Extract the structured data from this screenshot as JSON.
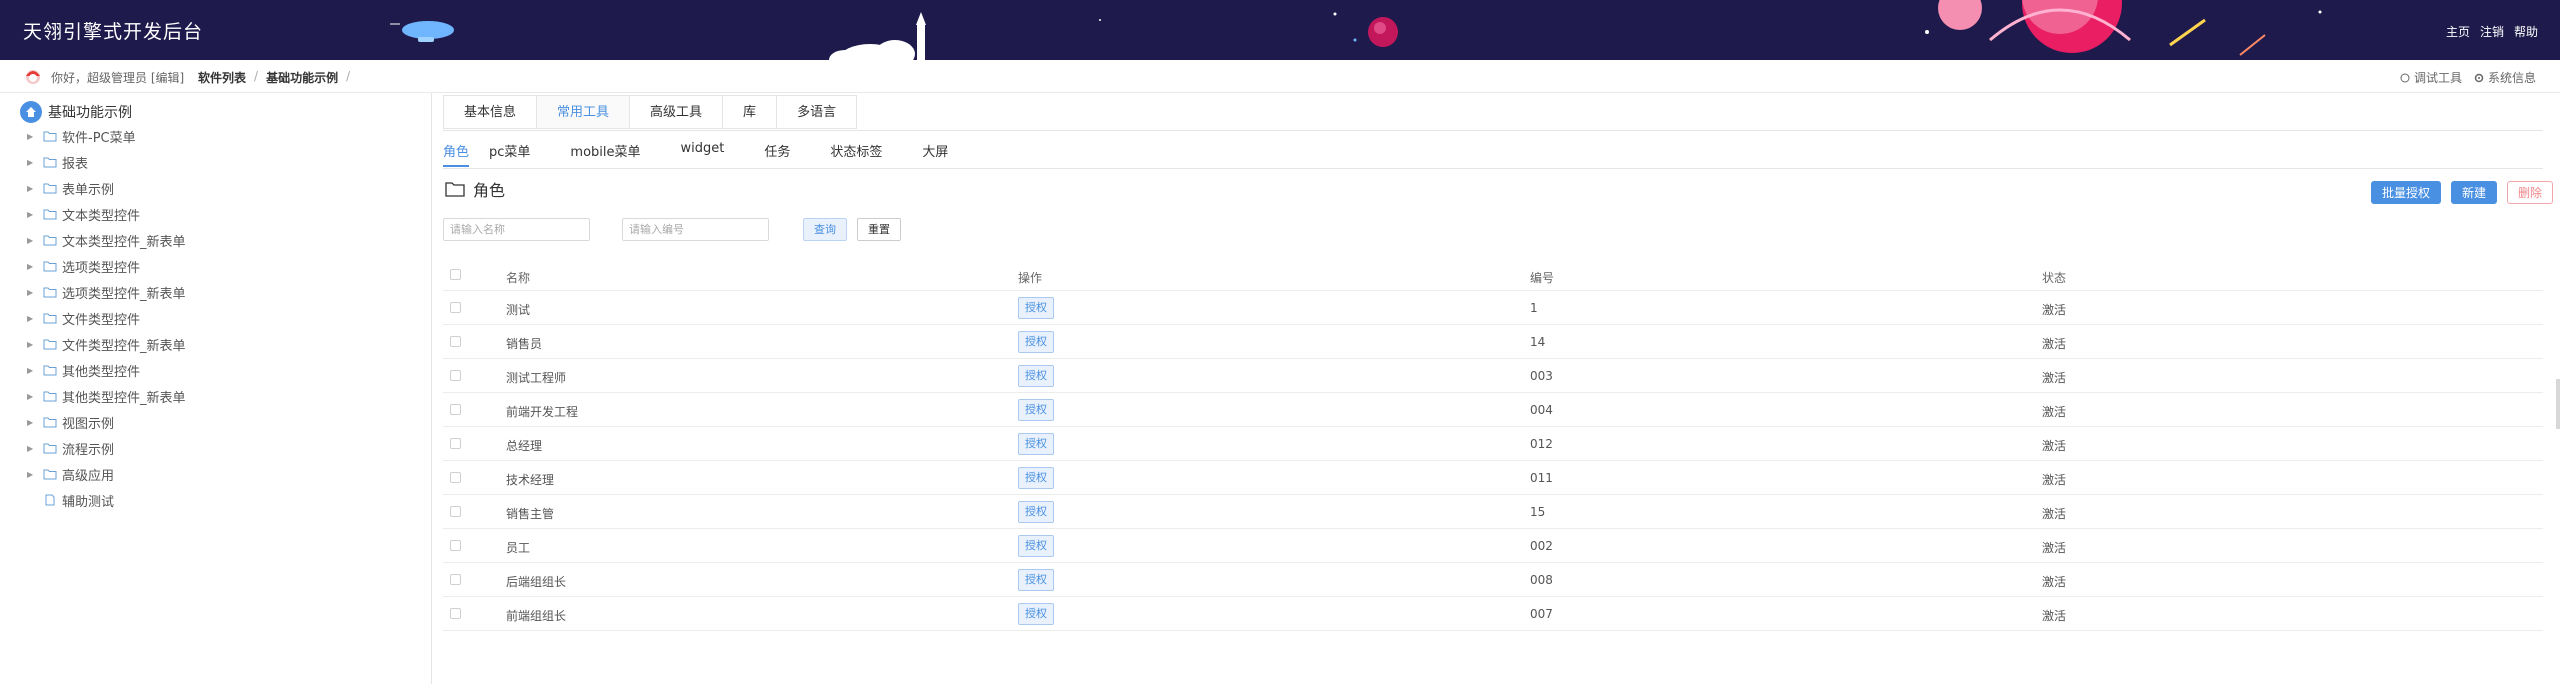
{
  "header": {
    "title": "天翎引擎式开发后台",
    "nav": [
      "主页",
      "注销",
      "帮助"
    ]
  },
  "subbar": {
    "greeting": "你好，超级管理员 [编辑]",
    "breadcrumb": [
      "软件列表",
      "基础功能示例"
    ],
    "tools": [
      "调试工具",
      "系统信息"
    ]
  },
  "sidebar": {
    "root": "基础功能示例",
    "items": [
      {
        "label": "软件-PC菜单",
        "icon": "folder-icon"
      },
      {
        "label": "报表",
        "icon": "folder-icon"
      },
      {
        "label": "表单示例",
        "icon": "folder-icon"
      },
      {
        "label": "文本类型控件",
        "icon": "folder-icon"
      },
      {
        "label": "文本类型控件_新表单",
        "icon": "folder-icon"
      },
      {
        "label": "选项类型控件",
        "icon": "folder-icon"
      },
      {
        "label": "选项类型控件_新表单",
        "icon": "folder-icon"
      },
      {
        "label": "文件类型控件",
        "icon": "folder-icon"
      },
      {
        "label": "文件类型控件_新表单",
        "icon": "folder-icon"
      },
      {
        "label": "其他类型控件",
        "icon": "folder-icon"
      },
      {
        "label": "其他类型控件_新表单",
        "icon": "folder-icon"
      },
      {
        "label": "视图示例",
        "icon": "folder-icon"
      },
      {
        "label": "流程示例",
        "icon": "folder-icon"
      },
      {
        "label": "高级应用",
        "icon": "folder-icon"
      },
      {
        "label": "辅助测试",
        "icon": "file-icon"
      }
    ]
  },
  "tabs": [
    "基本信息",
    "常用工具",
    "高级工具",
    "库",
    "多语言"
  ],
  "active_tab": "常用工具",
  "subtabs": [
    "角色",
    "pc菜单",
    "mobile菜单",
    "widget",
    "任务",
    "状态标签",
    "大屏"
  ],
  "active_subtab": "角色",
  "section": {
    "title": "角色",
    "buttons": {
      "batch": "批量授权",
      "new": "新建",
      "delete": "删除"
    }
  },
  "filters": {
    "name_placeholder": "请输入名称",
    "code_placeholder": "请输入编号",
    "query": "查询",
    "reset": "重置"
  },
  "table": {
    "headers": {
      "name": "名称",
      "op": "操作",
      "num": "编号",
      "status": "状态"
    },
    "action_label": "授权",
    "rows": [
      {
        "name": "测试",
        "num": "1",
        "status": "激活"
      },
      {
        "name": "销售员",
        "num": "14",
        "status": "激活"
      },
      {
        "name": "测试工程师",
        "num": "003",
        "status": "激活"
      },
      {
        "name": "前端开发工程",
        "num": "004",
        "status": "激活"
      },
      {
        "name": "总经理",
        "num": "012",
        "status": "激活"
      },
      {
        "name": "技术经理",
        "num": "011",
        "status": "激活"
      },
      {
        "name": "销售主管",
        "num": "15",
        "status": "激活"
      },
      {
        "name": "员工",
        "num": "002",
        "status": "激活"
      },
      {
        "name": "后端组组长",
        "num": "008",
        "status": "激活"
      },
      {
        "name": "前端组组长",
        "num": "007",
        "status": "激活"
      }
    ]
  },
  "colors": {
    "header_bg": "#1f1a4c",
    "accent": "#4a90e2",
    "danger": "#f0868a"
  }
}
